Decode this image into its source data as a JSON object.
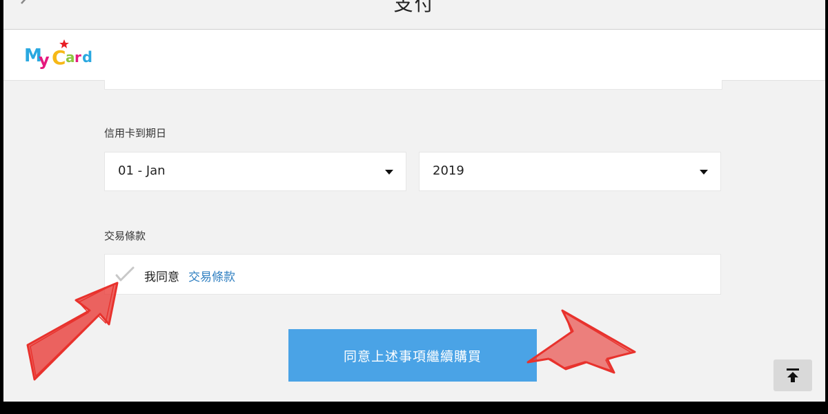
{
  "header": {
    "title": "支付"
  },
  "brand": {
    "name": "MyCard"
  },
  "expiry": {
    "label": "信用卡到期日",
    "month_value": "01 - Jan",
    "year_value": "2019"
  },
  "terms": {
    "section_label": "交易條款",
    "agree_text": "我同意",
    "terms_link": "交易條款"
  },
  "submit": {
    "label": "同意上述事項繼續購買"
  },
  "colors": {
    "accent": "#4aa3e6",
    "link": "#2f7fc1",
    "annotation": "#e8322d"
  },
  "icons": {
    "back": "chevron-left-icon",
    "check": "check-icon",
    "scroll_top": "arrow-up-to-line-icon"
  }
}
